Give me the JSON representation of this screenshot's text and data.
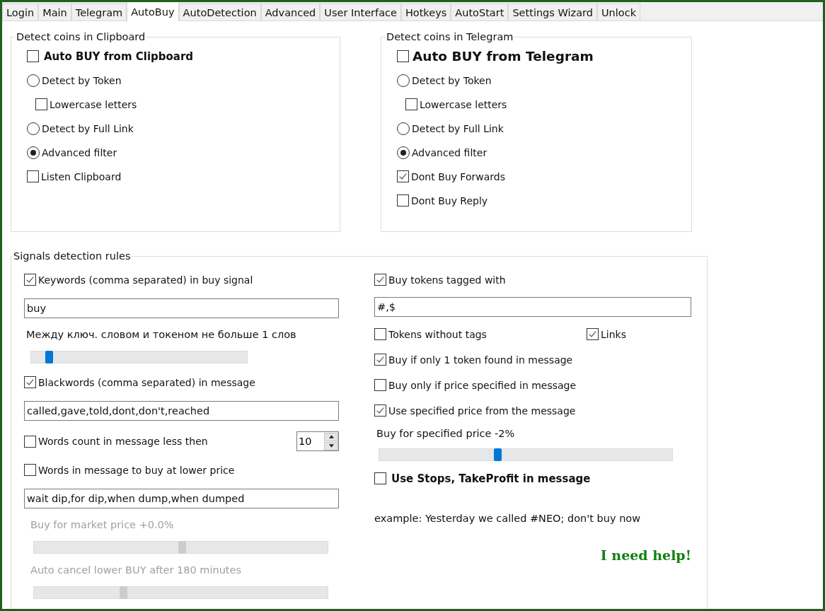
{
  "tabs": [
    {
      "label": "Login",
      "selected": false
    },
    {
      "label": "Main",
      "selected": false
    },
    {
      "label": "Telegram",
      "selected": false
    },
    {
      "label": "AutoBuy",
      "selected": true
    },
    {
      "label": "AutoDetection",
      "selected": false
    },
    {
      "label": "Advanced",
      "selected": false
    },
    {
      "label": "User Interface",
      "selected": false
    },
    {
      "label": "Hotkeys",
      "selected": false
    },
    {
      "label": "AutoStart",
      "selected": false
    },
    {
      "label": "Settings Wizard",
      "selected": false
    },
    {
      "label": "Unlock",
      "selected": false
    }
  ],
  "groups": [
    {
      "title": "Detect coins in Clipboard",
      "items": [
        {
          "kind": "main_checkbox",
          "label": "Auto BUY from Clipboard",
          "checked": false
        },
        {
          "kind": "radio",
          "label": "Detect by Token",
          "selected": false,
          "children": [
            {
              "kind": "checkbox",
              "label": "Lowercase letters",
              "checked": false
            }
          ]
        },
        {
          "kind": "radio",
          "label": "Detect by Full Link",
          "selected": false
        },
        {
          "kind": "radio",
          "label": "Advanced filter",
          "selected": true
        },
        {
          "kind": "checkbox",
          "label": "Listen Clipboard",
          "checked": false
        }
      ]
    },
    {
      "title": "Detect coins in Telegram",
      "items": [
        {
          "kind": "large_checkbox",
          "label": "Auto BUY from Telegram",
          "checked": false
        },
        {
          "kind": "radio",
          "label": "Detect by Token",
          "selected": false,
          "children": [
            {
              "kind": "checkbox",
              "label": "Lowercase letters",
              "checked": false
            }
          ]
        },
        {
          "kind": "radio",
          "label": "Detect by Full Link",
          "selected": false
        },
        {
          "kind": "radio",
          "label": "Advanced filter",
          "selected": true
        },
        {
          "kind": "checkbox",
          "label": "Dont Buy Forwards",
          "checked": true
        },
        {
          "kind": "checkbox",
          "label": "Dont Buy Reply",
          "checked": false
        }
      ]
    }
  ],
  "signals": {
    "title": "Signals detection rules",
    "left": [
      {
        "kind": "checkbox",
        "label": "Keywords (comma separated) in buy signal",
        "checked": true
      },
      {
        "kind": "field",
        "value": "buy"
      },
      {
        "kind": "caption",
        "text": "Между ключ. словом и токеном не больше 1 слов",
        "disabled": false
      },
      {
        "kind": "slider",
        "level": 0.08,
        "disabled": false
      },
      {
        "kind": "checkbox",
        "label": "Blackwords (comma separated) in message",
        "checked": true
      },
      {
        "kind": "field",
        "value": "called,gave,told,dont,don't,reached"
      },
      {
        "kind": "count",
        "label": "Words count in message less then",
        "checked": false,
        "value": "10"
      },
      {
        "kind": "checkbox",
        "label": "Words in message to buy at lower price",
        "checked": false
      },
      {
        "kind": "field",
        "value": "wait dip,for dip,when dump,when dumped"
      },
      {
        "kind": "caption",
        "text": "Buy for market price +0.0%",
        "disabled": true
      },
      {
        "kind": "slider",
        "level": 0.5,
        "disabled": true
      },
      {
        "kind": "caption",
        "text": "Auto cancel lower BUY after 180 minutes",
        "disabled": true
      },
      {
        "kind": "slider",
        "level": 0.3,
        "disabled": true
      }
    ],
    "right": [
      {
        "kind": "checkbox",
        "label": "Buy tokens tagged with",
        "checked": true
      },
      {
        "kind": "field",
        "value": "#,$"
      },
      {
        "kind": "pair",
        "checks": [
          {
            "label": "Tokens without tags",
            "checked": false
          },
          {
            "label": "Links",
            "checked": true
          }
        ]
      },
      {
        "kind": "checkbox",
        "label": "Buy if only 1 token found in message",
        "checked": true
      },
      {
        "kind": "checkbox",
        "label": "Buy only if price specified in message",
        "checked": false
      },
      {
        "kind": "checkbox",
        "label": "Use specified price from the message",
        "checked": true
      },
      {
        "kind": "caption",
        "text": "Buy for specified price -2%",
        "disabled": false
      },
      {
        "kind": "slider",
        "level": 0.4,
        "disabled": false
      },
      {
        "kind": "main_checkbox",
        "label": "Use Stops, TakeProfit in message",
        "checked": false
      },
      {
        "kind": "note",
        "text": "example: Yesterday we called #NEO; don't buy now"
      },
      {
        "kind": "help",
        "text": "I need help!"
      }
    ]
  }
}
